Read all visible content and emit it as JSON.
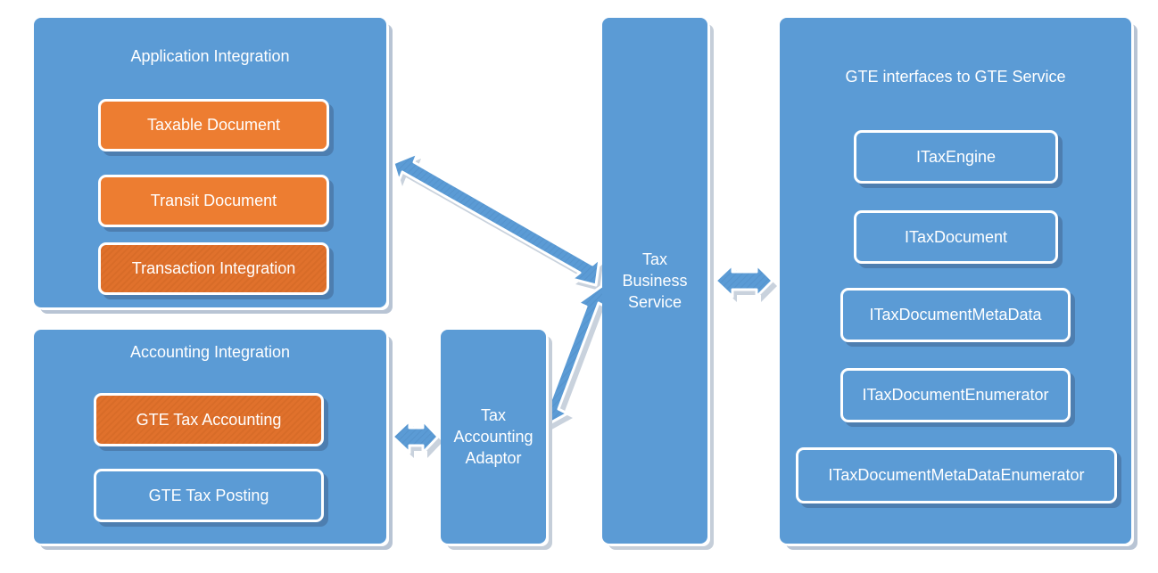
{
  "diagram": {
    "application_integration": {
      "title": "Application Integration",
      "items": [
        {
          "label": "Taxable Document",
          "style": "orange"
        },
        {
          "label": "Transit Document",
          "style": "orange"
        },
        {
          "label": "Transaction Integration",
          "style": "orange-dark"
        }
      ]
    },
    "accounting_integration": {
      "title": "Accounting Integration",
      "items": [
        {
          "label": "GTE Tax Accounting",
          "style": "orange-dark"
        },
        {
          "label": "GTE Tax Posting",
          "style": "blue"
        }
      ]
    },
    "tax_accounting_adaptor": {
      "lines": [
        "Tax",
        "Accounting",
        "Adaptor"
      ]
    },
    "tax_business_service": {
      "lines": [
        "Tax",
        "Business",
        "Service"
      ]
    },
    "gte_interfaces": {
      "title": "GTE interfaces to GTE Service",
      "items": [
        {
          "label": "ITaxEngine"
        },
        {
          "label": "ITaxDocument"
        },
        {
          "label": "ITaxDocumentMetaData"
        },
        {
          "label": "ITaxDocumentEnumerator"
        },
        {
          "label": "ITaxDocumentMetaDataEnumerator"
        }
      ]
    },
    "connections": [
      {
        "from": "Application Integration",
        "to": "Tax Business Service",
        "type": "bidirectional-arrow"
      },
      {
        "from": "Tax Accounting Adaptor",
        "to": "Tax Business Service",
        "type": "bidirectional-arrow"
      },
      {
        "from": "Accounting Integration",
        "to": "Tax Accounting Adaptor",
        "type": "bidirectional-arrow"
      },
      {
        "from": "Tax Business Service",
        "to": "GTE interfaces to GTE Service",
        "type": "bidirectional-arrow"
      }
    ],
    "colors": {
      "container_blue": "#5b9bd5",
      "orange": "#ed7d31",
      "orange_dark": "#e0712c",
      "border": "#ffffff",
      "shadow": "#b8c4d4"
    }
  }
}
